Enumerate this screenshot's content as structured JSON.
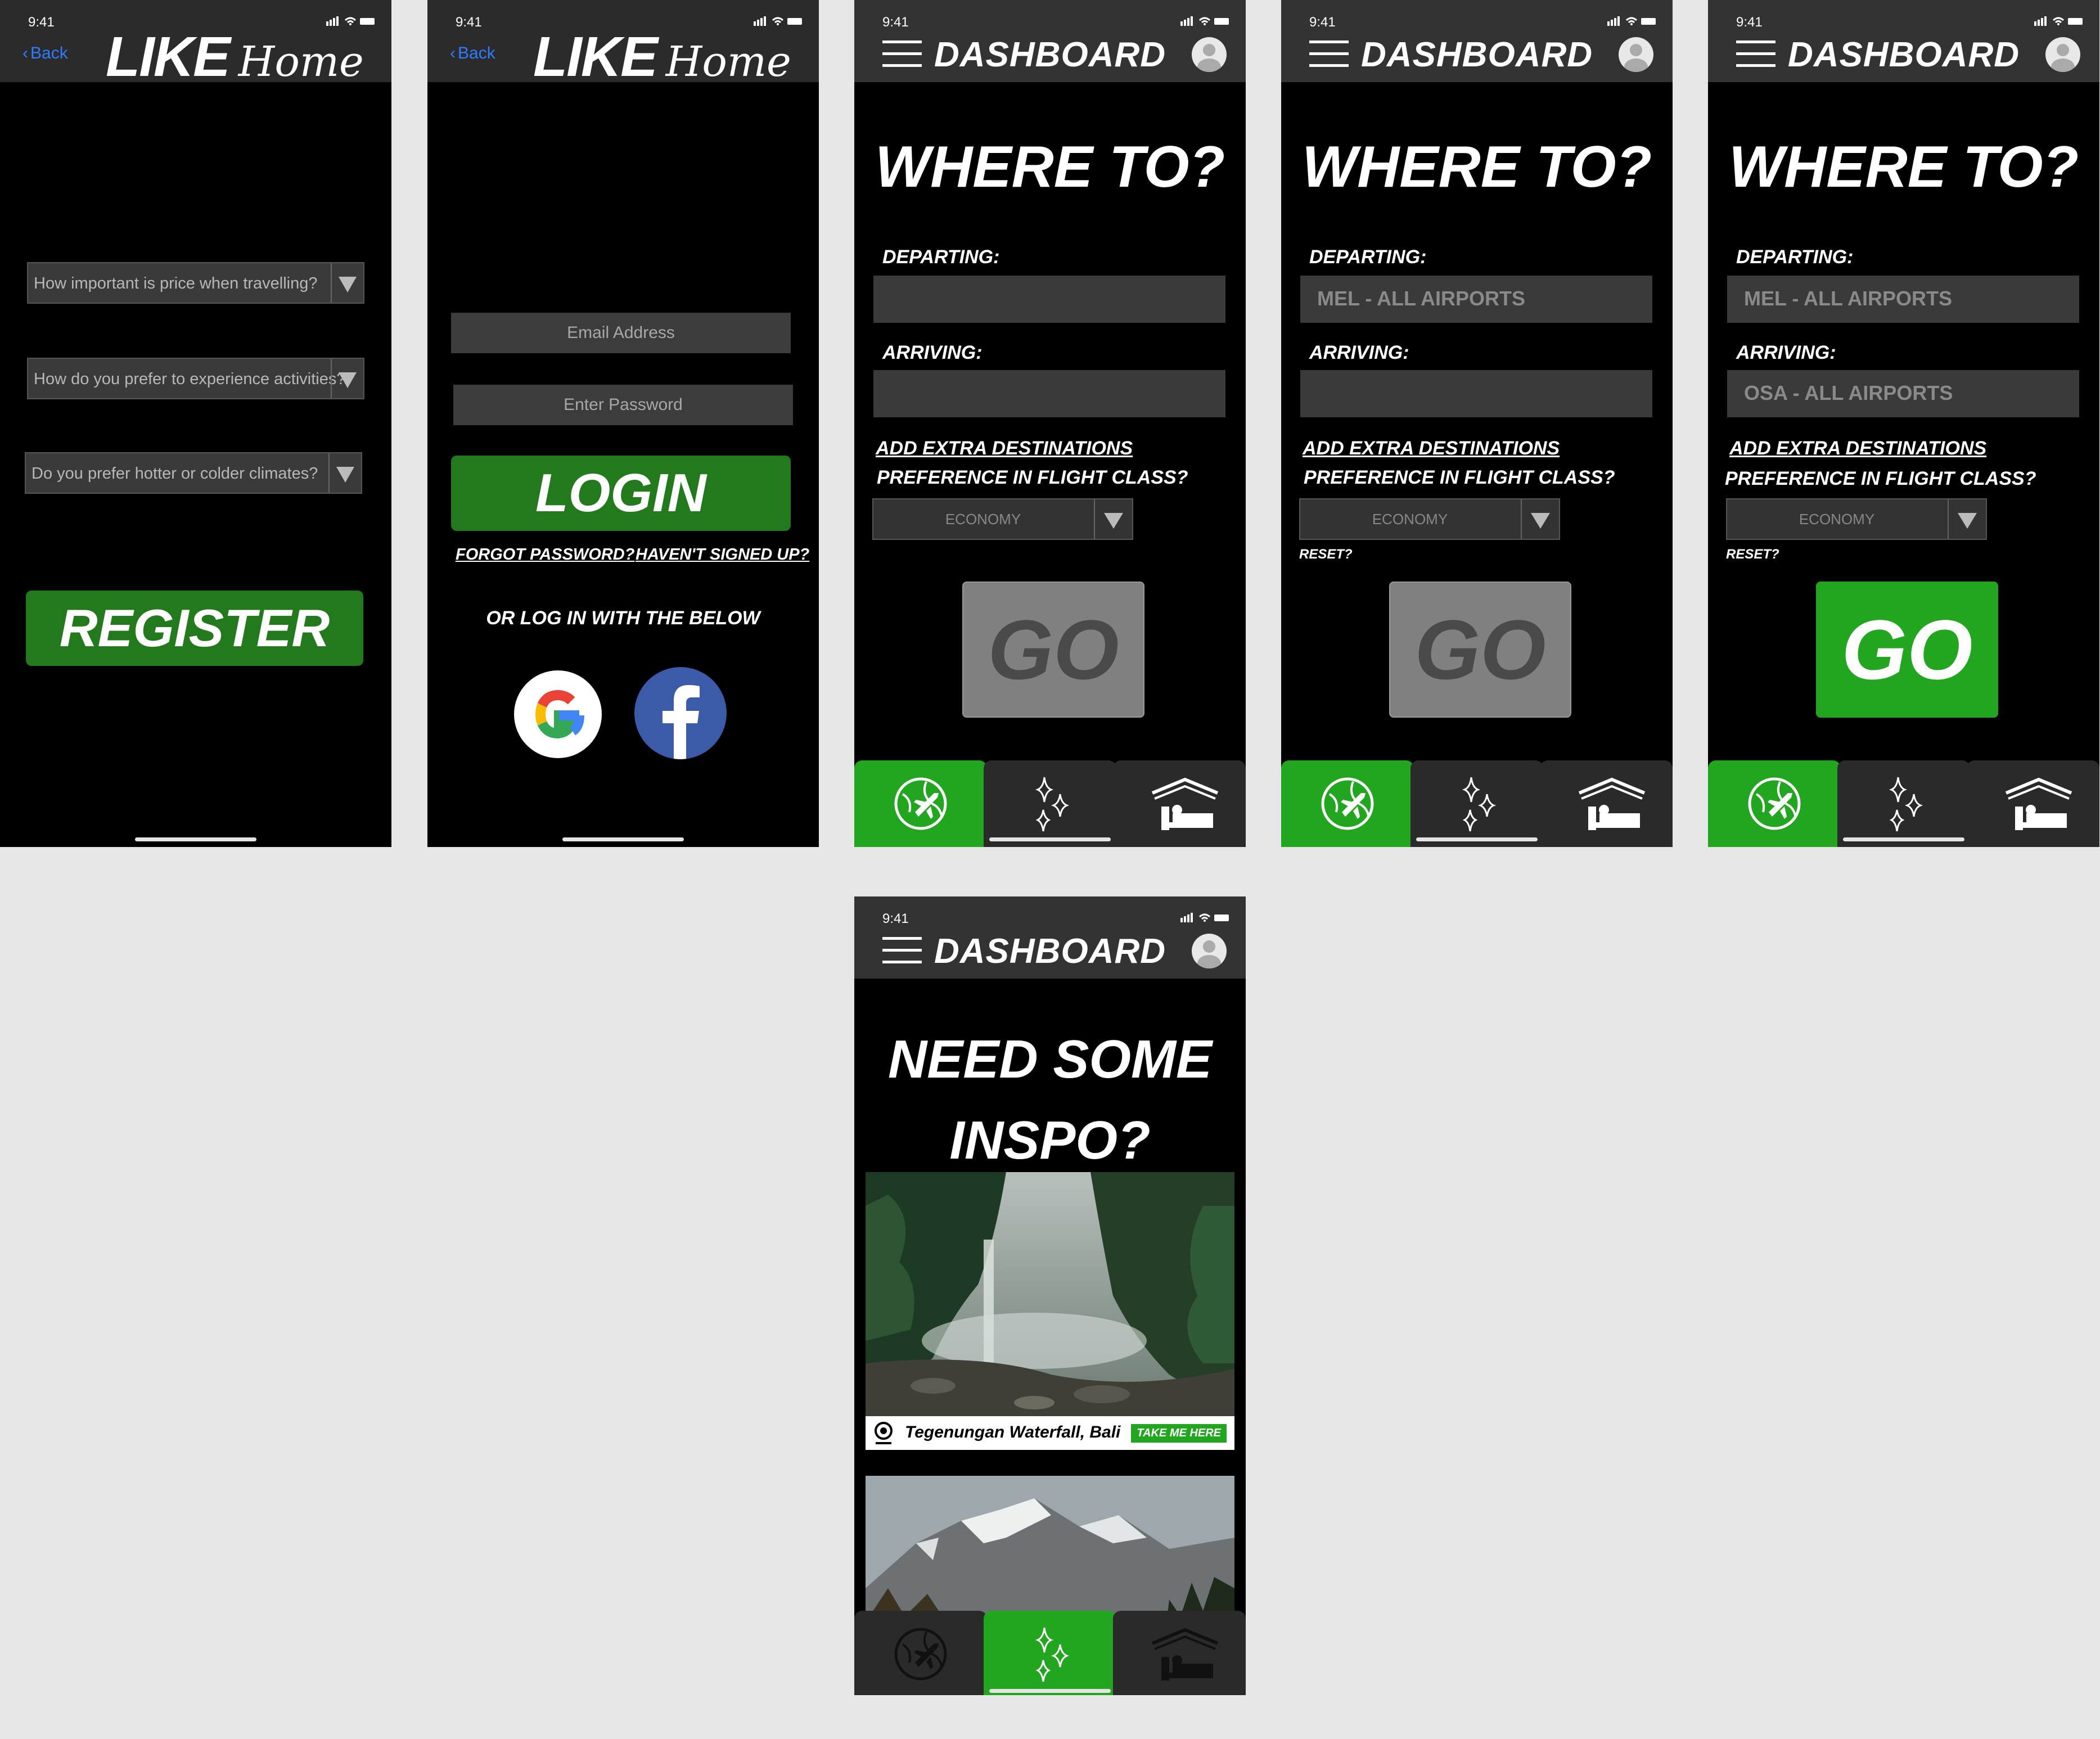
{
  "status": {
    "time": "9:41"
  },
  "register": {
    "back": "Back",
    "brand_like": "LIKE",
    "brand_home": "Home",
    "questions": [
      "How important is price when travelling?",
      "How do you prefer to experience activities?",
      "Do you prefer hotter or colder climates?"
    ],
    "register_label": "REGISTER"
  },
  "login": {
    "back": "Back",
    "brand_like": "LIKE",
    "brand_home": "Home",
    "email_placeholder": "Email Address",
    "password_placeholder": "Enter Password",
    "login_label": "LOGIN",
    "forgot": "FORGOT PASSWORD?",
    "signup": "HAVEN'T SIGNED UP?",
    "social_text": "OR LOG IN WITH THE BELOW"
  },
  "dashboard": {
    "title": "DASHBOARD",
    "heading": "WHERE TO?",
    "departing_label": "DEPARTING:",
    "arriving_label": "ARRIVING:",
    "extra_dest": "ADD EXTRA DESTINATIONS",
    "class_question": "PREFERENCE IN FLIGHT CLASS?",
    "class_value": "ECONOMY",
    "reset": "RESET?",
    "go": "GO",
    "departing_value": "MEL - ALL AIRPORTS",
    "arriving_value": "OSA - ALL AIRPORTS"
  },
  "inspo": {
    "title": "DASHBOARD",
    "heading_line1": "NEED SOME",
    "heading_line2": "INSPO?",
    "place": "Tegenungan Waterfall, Bali",
    "take_me": "TAKE ME HERE"
  },
  "icons": {
    "flights_tab": "globe-plane-icon",
    "inspo_tab": "sparkles-icon",
    "hotel_tab": "bed-icon"
  },
  "colors": {
    "accent_green": "#23a61f",
    "dark_green": "#237a1c",
    "topbar": "#333333"
  }
}
